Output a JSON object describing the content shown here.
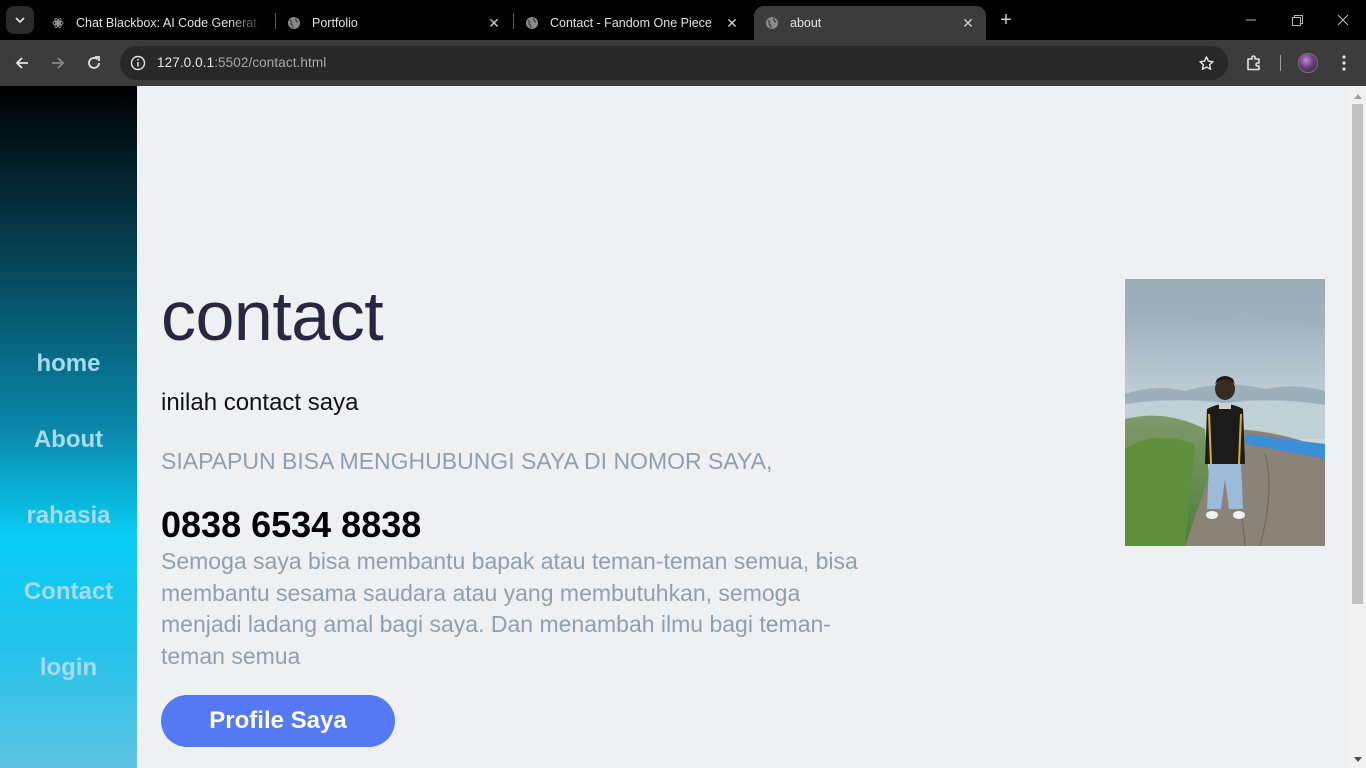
{
  "browser": {
    "tabs": [
      {
        "title": "Chat Blackbox: AI Code Generat",
        "favicon": "blackbox-icon",
        "active": false
      },
      {
        "title": "Portfolio",
        "favicon": "globe-icon",
        "active": false
      },
      {
        "title": "Contact - Fandom One Piece",
        "favicon": "globe-icon",
        "active": false
      },
      {
        "title": "about",
        "favicon": "globe-icon",
        "active": true
      }
    ],
    "url_host": "127.0.0.1",
    "url_rest": ":5502/contact.html"
  },
  "sidebar": {
    "items": [
      {
        "label": "home"
      },
      {
        "label": "About"
      },
      {
        "label": "rahasia"
      },
      {
        "label": "Contact"
      },
      {
        "label": "login"
      }
    ]
  },
  "main": {
    "heading": "contact",
    "subheading": "inilah contact saya",
    "notice": "SIAPAPUN BISA MENGHUBUNGI SAYA DI NOMOR SAYA,",
    "phone": "0838 6534 8838",
    "description": "Semoga saya bisa membantu bapak atau teman-teman semua, bisa membantu sesama saudara atau yang membutuhkan, semoga menjadi ladang amal bagi saya. Dan menambah ilmu bagi teman-teman semua",
    "button_label": "Profile Saya"
  },
  "colors": {
    "accent_button": "#5578f4",
    "page_background": "#eff0f2",
    "heading": "#2b2640",
    "muted_text": "#8ea0ad",
    "sidebar_text": "#a6dbef"
  }
}
